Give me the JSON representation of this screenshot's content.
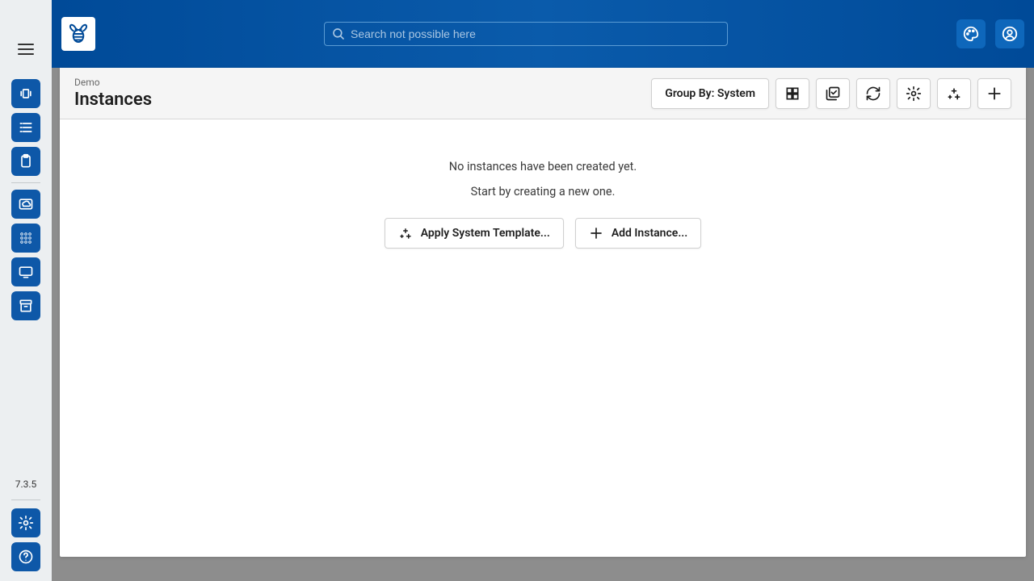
{
  "sidebar": {
    "version": "7.3.5"
  },
  "search": {
    "placeholder": "Search not possible here"
  },
  "header": {
    "breadcrumb": "Demo",
    "title": "Instances",
    "group_by_label": "Group By: System"
  },
  "empty": {
    "line1": "No instances have been created yet.",
    "line2": "Start by creating a new one.",
    "apply_template_label": "Apply System Template...",
    "add_instance_label": "Add Instance..."
  }
}
